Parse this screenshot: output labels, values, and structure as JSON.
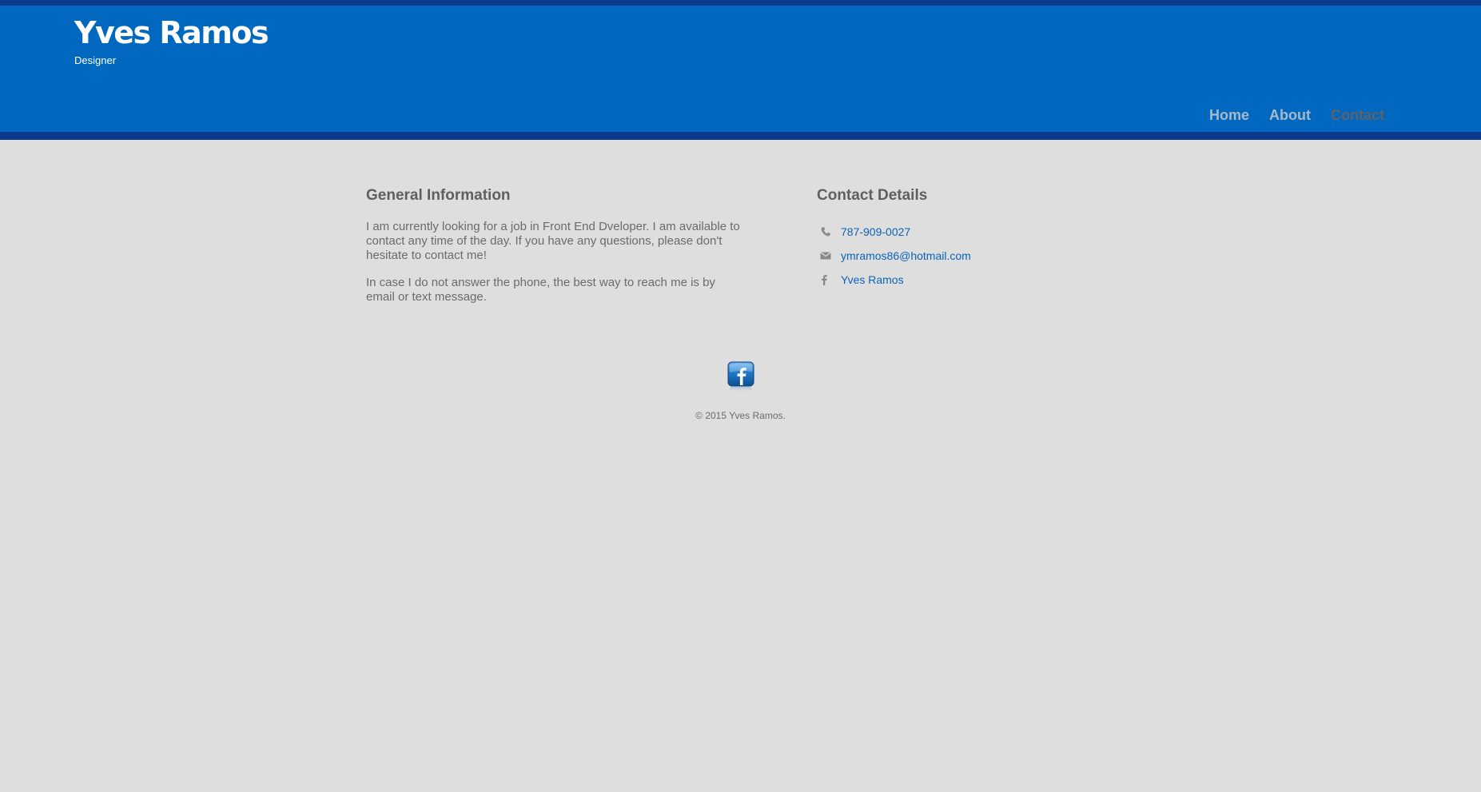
{
  "header": {
    "name": "Yves Ramos",
    "tagline": "Designer"
  },
  "nav": {
    "items": [
      {
        "label": "Home"
      },
      {
        "label": "About"
      },
      {
        "label": "Contact"
      }
    ],
    "active": "Contact"
  },
  "general_info": {
    "title": "General Information",
    "paragraphs": [
      "I am currently looking for a job in Front End Dveloper. I am available to contact any time of the day. If you have any questions, please don't hesitate to contact me!",
      "In case I do not answer the phone, the best way to reach me is by email or text message."
    ]
  },
  "contact_details": {
    "title": "Contact Details",
    "items": [
      {
        "icon": "phone-icon",
        "text": "787-909-0027"
      },
      {
        "icon": "mail-icon",
        "text": "ymramos86@hotmail.com"
      },
      {
        "icon": "facebook-icon",
        "text": "Yves Ramos"
      }
    ]
  },
  "footer": {
    "social_icon": "facebook-icon",
    "copyright": "© 2015 Yves Ramos."
  },
  "colors": {
    "header_blue": "#0069bf",
    "header_dark": "#0a3a8c",
    "background": "#dedede",
    "link": "#0a63b8"
  }
}
